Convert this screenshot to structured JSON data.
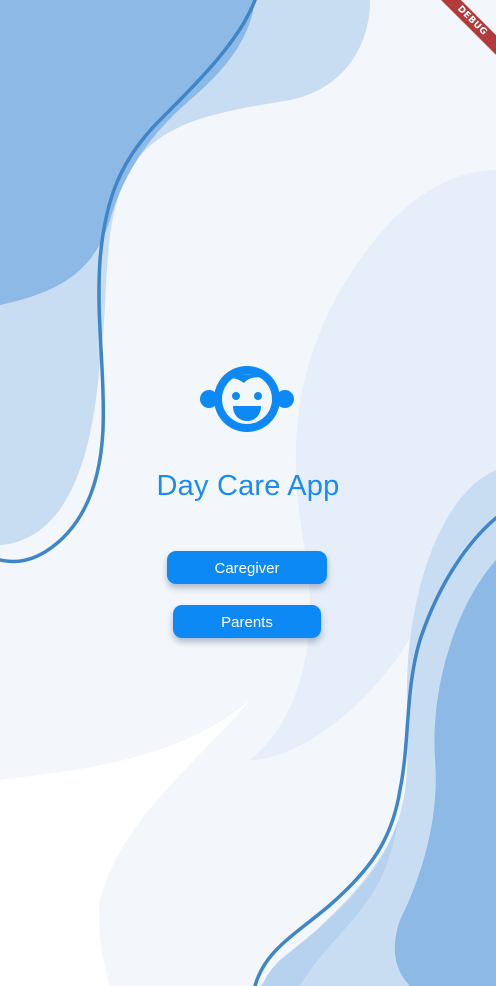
{
  "app": {
    "title": "Day Care App",
    "icon": "child-face-icon"
  },
  "buttons": {
    "caregiver_label": "Caregiver",
    "parents_label": "Parents"
  },
  "debug_banner": {
    "label": "DEBUG"
  },
  "colors": {
    "accent": "#0c89f5",
    "title": "#1a8cf0",
    "background": "#ffffff",
    "blob_light": "#c8ddf2",
    "blob_mid": "#8db9e6",
    "blob_pale": "#e8f0fa",
    "curve_stroke": "#3f86c8",
    "debug_ribbon": "#b13b3b"
  }
}
